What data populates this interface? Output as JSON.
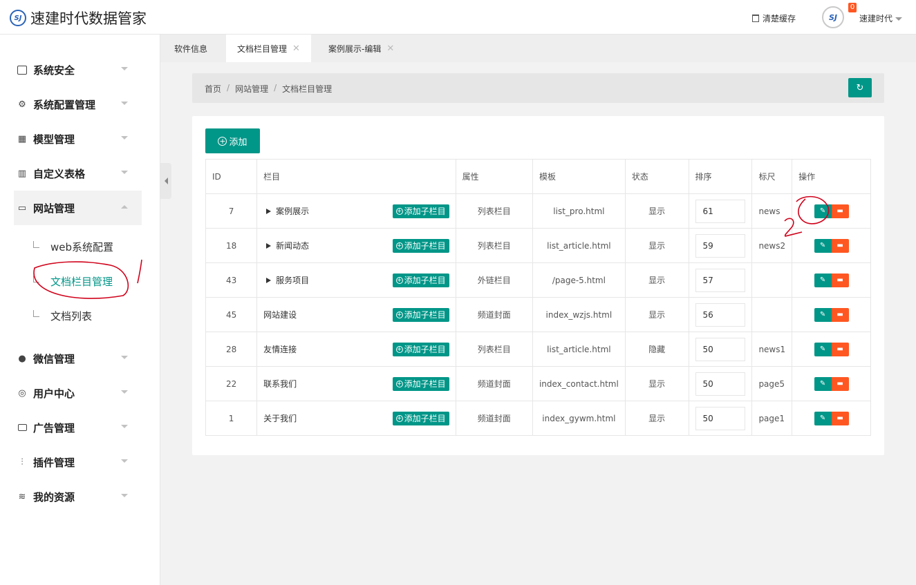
{
  "app": {
    "logo_mark": "SJ",
    "title": "速建时代数据管家"
  },
  "header": {
    "clear_cache": "清楚缓存",
    "avatar_mark": "SJ",
    "badge": "0",
    "user": "速建时代"
  },
  "sidebar": {
    "items": [
      {
        "label": "系统安全",
        "icon": "calendar-icon"
      },
      {
        "label": "系统配置管理",
        "icon": "gear-icon"
      },
      {
        "label": "模型管理",
        "icon": "grid-icon"
      },
      {
        "label": "自定义表格",
        "icon": "columns-icon"
      },
      {
        "label": "网站管理",
        "icon": "folder-icon"
      },
      {
        "label": "微信管理",
        "icon": "wechat-icon"
      },
      {
        "label": "用户中心",
        "icon": "user-icon"
      },
      {
        "label": "广告管理",
        "icon": "ad-icon"
      },
      {
        "label": "插件管理",
        "icon": "sliders-icon"
      },
      {
        "label": "我的资源",
        "icon": "layers-icon"
      }
    ],
    "sub_items": [
      {
        "label": "web系统配置"
      },
      {
        "label": "文档栏目管理"
      },
      {
        "label": "文档列表"
      }
    ]
  },
  "tabs": [
    {
      "label": "软件信息"
    },
    {
      "label": "文档栏目管理"
    },
    {
      "label": "案例展示-编辑"
    }
  ],
  "breadcrumb": {
    "home": "首页",
    "level1": "网站管理",
    "level2": "文档栏目管理",
    "separator": "/"
  },
  "toolbar": {
    "add_label": "添加"
  },
  "table": {
    "headers": [
      "ID",
      "栏目",
      "属性",
      "模板",
      "状态",
      "排序",
      "标尺",
      "操作"
    ],
    "add_sub_label": "添加子栏目",
    "rows": [
      {
        "id": "7",
        "name": "案例展示",
        "expandable": true,
        "attr": "列表栏目",
        "template": "list_pro.html",
        "status": "显示",
        "sort": "61",
        "mark": "news"
      },
      {
        "id": "18",
        "name": "新闻动态",
        "expandable": true,
        "attr": "列表栏目",
        "template": "list_article.html",
        "status": "显示",
        "sort": "59",
        "mark": "news2"
      },
      {
        "id": "43",
        "name": "服务项目",
        "expandable": true,
        "attr": "外链栏目",
        "template": "/page-5.html",
        "status": "显示",
        "sort": "57",
        "mark": ""
      },
      {
        "id": "45",
        "name": "网站建设",
        "expandable": false,
        "attr": "频道封面",
        "template": "index_wzjs.html",
        "status": "显示",
        "sort": "56",
        "mark": ""
      },
      {
        "id": "28",
        "name": "友情连接",
        "expandable": false,
        "attr": "列表栏目",
        "template": "list_article.html",
        "status": "隐藏",
        "sort": "50",
        "mark": "news1"
      },
      {
        "id": "22",
        "name": "联系我们",
        "expandable": false,
        "attr": "频道封面",
        "template": "index_contact.html",
        "status": "显示",
        "sort": "50",
        "mark": "page5"
      },
      {
        "id": "1",
        "name": "关于我们",
        "expandable": false,
        "attr": "频道封面",
        "template": "index_gywm.html",
        "status": "显示",
        "sort": "50",
        "mark": "page1"
      }
    ]
  },
  "annotations": {
    "mark1": "1",
    "mark2": "2"
  },
  "colors": {
    "primary": "#009688",
    "danger": "#ff5722",
    "annotation": "#d0021b"
  }
}
